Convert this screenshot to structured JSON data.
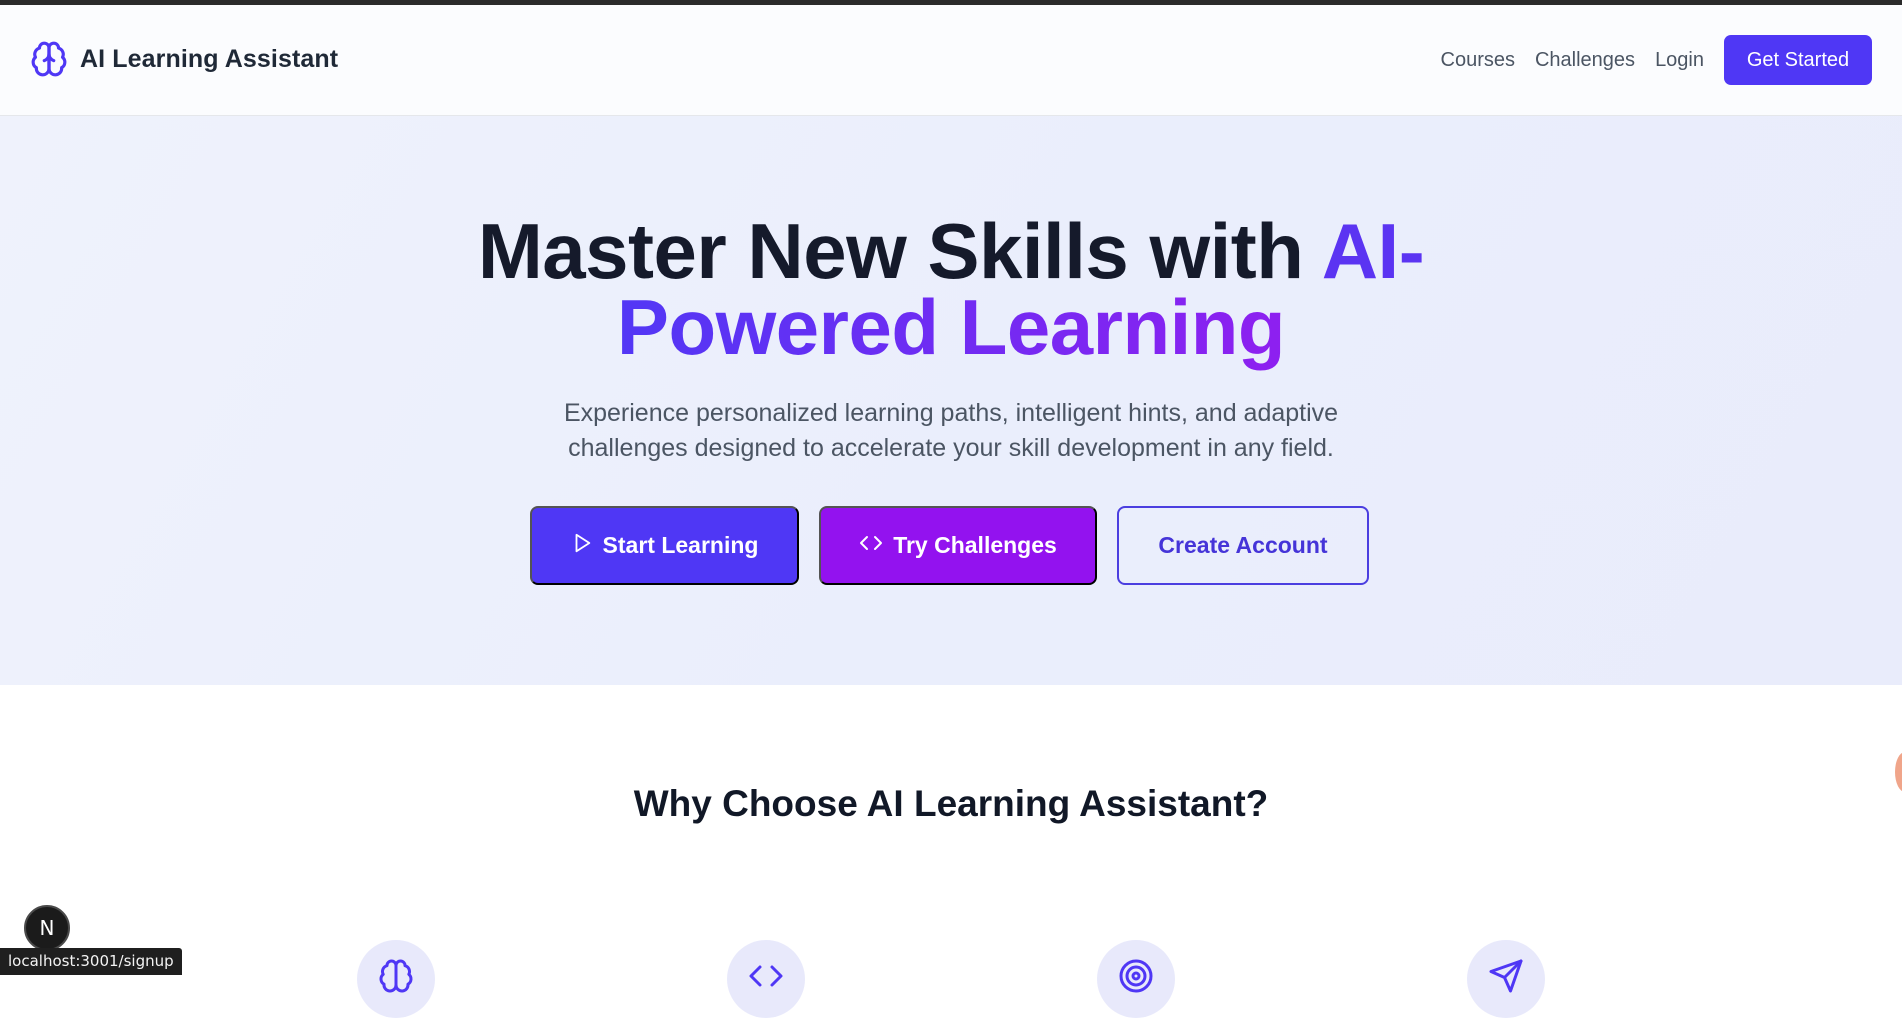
{
  "header": {
    "brand": "AI Learning Assistant",
    "nav": [
      "Courses",
      "Challenges",
      "Login"
    ],
    "cta": "Get Started"
  },
  "hero": {
    "title_part1": "Master New Skills with ",
    "title_accent_line1": "AI-",
    "title_accent_line2": "Powered Learning",
    "subtitle_line1": "Experience personalized learning paths, intelligent hints, and adaptive",
    "subtitle_line2": "challenges designed to accelerate your skill development in any field.",
    "buttons": {
      "start": "Start Learning",
      "try": "Try Challenges",
      "create": "Create Account"
    }
  },
  "features": {
    "title": "Why Choose AI Learning Assistant?",
    "icons": [
      "brain-icon",
      "code-icon",
      "target-icon",
      "send-icon"
    ]
  },
  "status_bar": {
    "url": "localhost:3001/signup"
  },
  "dev_badge": {
    "letter": "N"
  },
  "colors": {
    "primary": "#4f37f5",
    "purple": "#9312ef",
    "hero_bg": "#eaeefc",
    "text_dark": "#151a2b"
  }
}
